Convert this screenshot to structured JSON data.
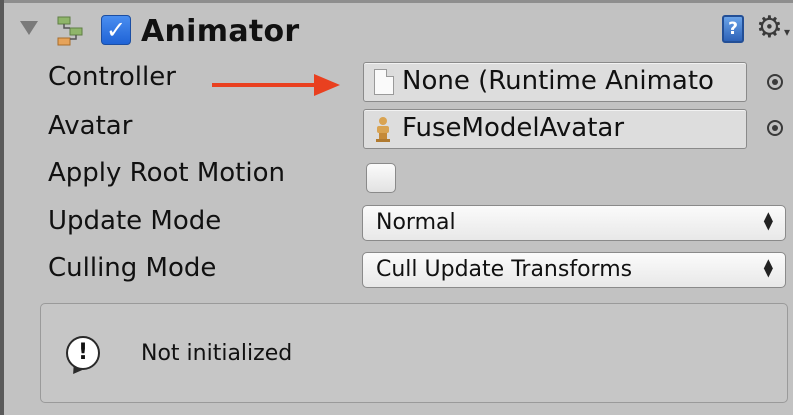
{
  "component": {
    "title": "Animator",
    "enabled": true,
    "icons": {
      "foldout": "foldout-triangle-icon",
      "component": "animator-component-icon",
      "help": "help-book-icon",
      "settings": "gear-icon"
    },
    "help_glyph": "?"
  },
  "properties": {
    "controller": {
      "label": "Controller",
      "value": "None (Runtime Animato",
      "icon": "file-icon"
    },
    "avatar": {
      "label": "Avatar",
      "value": "FuseModelAvatar",
      "icon": "avatar-icon"
    },
    "apply_root_motion": {
      "label": "Apply Root Motion",
      "checked": false
    },
    "update_mode": {
      "label": "Update Mode",
      "value": "Normal"
    },
    "culling_mode": {
      "label": "Culling Mode",
      "value": "Cull Update Transforms"
    }
  },
  "helpbox": {
    "icon": "info-icon",
    "glyph": "!",
    "message": "Not initialized"
  },
  "colors": {
    "annotation_arrow": "#e9401f",
    "checkbox_accent": "#2a6fe0",
    "panel_bg": "#c2c2c2"
  }
}
